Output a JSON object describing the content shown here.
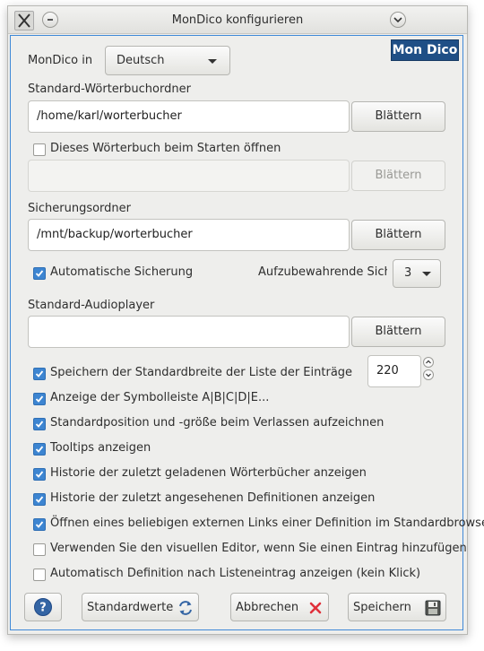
{
  "window": {
    "title": "MonDico konfigurieren"
  },
  "logo": {
    "text": "Mon Dico"
  },
  "language": {
    "label": "MonDico in",
    "selected": "Deutsch"
  },
  "dict_folder": {
    "label": "Standard-Wörterbuchordner",
    "value": "/home/karl/worterbucher",
    "browse": "Blättern"
  },
  "open_at_start": {
    "label": "Dieses Wörterbuch beim Starten öffnen",
    "checked": false,
    "value": "",
    "browse": "Blättern"
  },
  "backup_folder": {
    "label": "Sicherungsordner",
    "value": "/mnt/backup/worterbucher",
    "browse": "Blättern"
  },
  "auto_backup": {
    "label": "Automatische Sicherung",
    "checked": true,
    "keep_label": "Aufzubewahrende Sich",
    "keep_value": "3"
  },
  "audio": {
    "label": "Standard-Audioplayer",
    "value": "",
    "browse": "Blättern"
  },
  "list_width": {
    "label": "Speichern der Standardbreite der Liste der Einträge",
    "checked": true,
    "value": "220"
  },
  "options": [
    {
      "label": "Anzeige der Symbolleiste A|B|C|D|E...",
      "checked": true
    },
    {
      "label": "Standardposition und -größe beim Verlassen aufzeichnen",
      "checked": true
    },
    {
      "label": "Tooltips anzeigen",
      "checked": true
    },
    {
      "label": "Historie der zuletzt geladenen Wörterbücher anzeigen",
      "checked": true
    },
    {
      "label": "Historie der zuletzt angesehenen Definitionen anzeigen",
      "checked": true
    },
    {
      "label": "Öffnen eines beliebigen externen Links einer Definition im Standardbrowser",
      "checked": true
    },
    {
      "label": "Verwenden Sie den visuellen Editor, wenn Sie einen Eintrag hinzufügen",
      "checked": false
    },
    {
      "label": "Automatisch Definition nach Listeneintrag anzeigen (kein Klick)",
      "checked": false
    }
  ],
  "footer": {
    "defaults": "Standardwerte",
    "cancel": "Abbrechen",
    "save": "Speichern"
  },
  "colors": {
    "accent": "#3d85d1",
    "cancel_red": "#e0303a",
    "refresh_blue": "#3465a4"
  }
}
